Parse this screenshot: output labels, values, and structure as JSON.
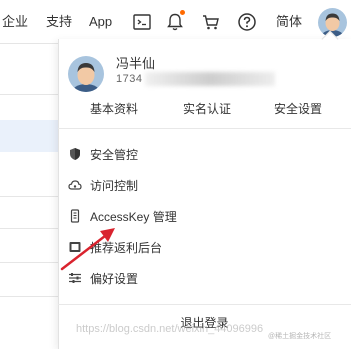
{
  "nav": {
    "items": [
      {
        "label": "企业"
      },
      {
        "label": "支持"
      },
      {
        "label": "App"
      }
    ],
    "language_label": "简体",
    "notification_dot_color": "#ff6a00"
  },
  "user": {
    "name": "冯半仙",
    "phone": "1734",
    "phone_obscured": true
  },
  "quick_links": [
    {
      "label": "基本资料"
    },
    {
      "label": "实名认证"
    },
    {
      "label": "安全设置"
    }
  ],
  "menu": [
    {
      "label": "安全管控",
      "icon": "shield-icon"
    },
    {
      "label": "访问控制",
      "icon": "cloud-icon"
    },
    {
      "label": "AccessKey 管理",
      "icon": "key-icon"
    },
    {
      "label": "推荐返利后台",
      "icon": "gift-icon"
    },
    {
      "label": "偏好设置",
      "icon": "sliders-icon"
    }
  ],
  "logout_label": "退出登录",
  "watermark": {
    "text": "https://blog.csdn.net/weixin_44096996",
    "corner_text": "@稀土掘金技术社区"
  },
  "annotation": {
    "arrow_color": "#d9232e"
  }
}
